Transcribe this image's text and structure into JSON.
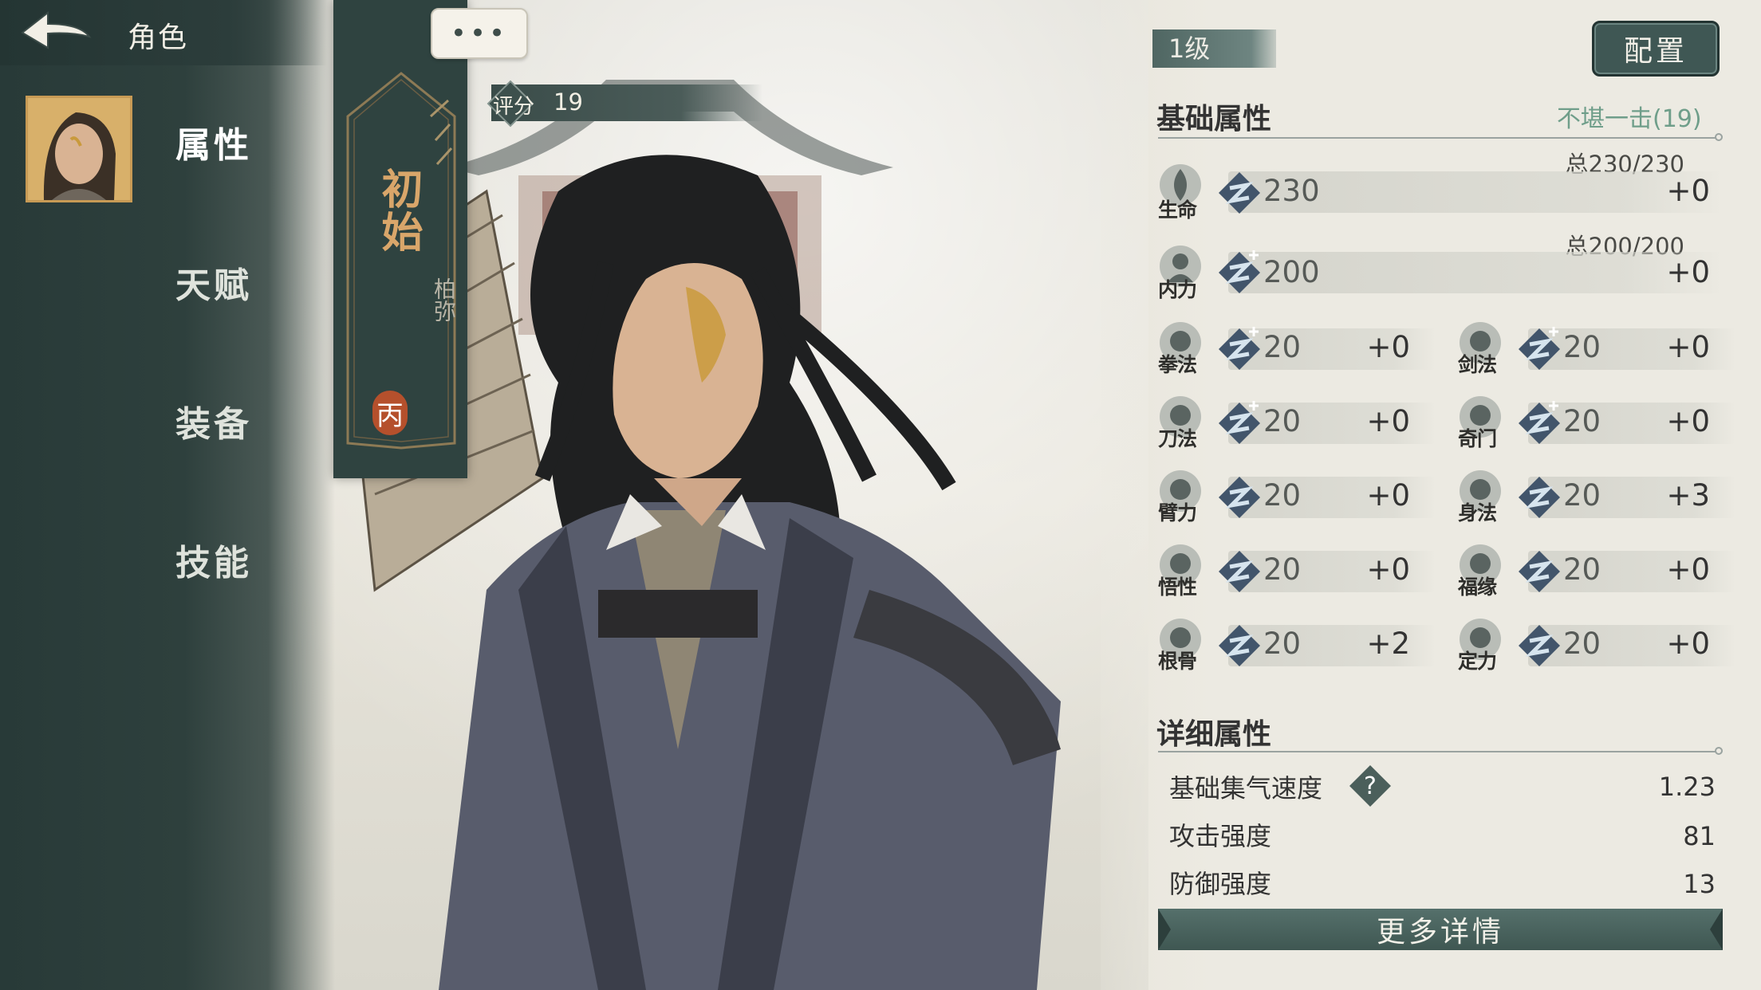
{
  "header": {
    "title": "角色",
    "chat_label": "•••"
  },
  "sidebar": {
    "items": [
      {
        "label": "属性",
        "active": true
      },
      {
        "label": "天赋",
        "active": false
      },
      {
        "label": "装备",
        "active": false
      },
      {
        "label": "技能",
        "active": false
      }
    ]
  },
  "banner": {
    "title": "初始",
    "name": "柏弥",
    "rank": "丙"
  },
  "score": {
    "label": "评分",
    "value": "19"
  },
  "level": {
    "label": "1级"
  },
  "config_label": "配置",
  "basic": {
    "title": "基础属性",
    "note": "不堪一击(19)",
    "hp": {
      "label": "生命",
      "value": "230",
      "bonus": "+0",
      "total": "总230/230",
      "icon": "leaf-icon"
    },
    "mp": {
      "label": "内力",
      "value": "200",
      "bonus": "+0",
      "total": "总200/200",
      "icon": "inner-force-icon"
    },
    "stats": [
      {
        "label": "拳法",
        "value": "20",
        "bonus": "+0",
        "icon": "fist-icon"
      },
      {
        "label": "剑法",
        "value": "20",
        "bonus": "+0",
        "icon": "sword-icon"
      },
      {
        "label": "刀法",
        "value": "20",
        "bonus": "+0",
        "icon": "blade-icon"
      },
      {
        "label": "奇门",
        "value": "20",
        "bonus": "+0",
        "icon": "odd-weapon-icon"
      },
      {
        "label": "臂力",
        "value": "20",
        "bonus": "+0",
        "icon": "arm-icon"
      },
      {
        "label": "身法",
        "value": "20",
        "bonus": "+3",
        "icon": "agility-icon"
      },
      {
        "label": "悟性",
        "value": "20",
        "bonus": "+0",
        "icon": "book-icon"
      },
      {
        "label": "福缘",
        "value": "20",
        "bonus": "+0",
        "icon": "fortune-icon"
      },
      {
        "label": "根骨",
        "value": "20",
        "bonus": "+2",
        "icon": "constitution-icon"
      },
      {
        "label": "定力",
        "value": "20",
        "bonus": "+0",
        "icon": "meditation-icon"
      }
    ]
  },
  "detail": {
    "title": "详细属性",
    "rows": [
      {
        "label": "基础集气速度",
        "value": "1.23"
      },
      {
        "label": "攻击强度",
        "value": "81"
      },
      {
        "label": "防御强度",
        "value": "13"
      }
    ],
    "more_label": "更多详情"
  },
  "colors": {
    "accent": "#3f5754",
    "sidebar": "#2e403d",
    "note": "#6f9e8a",
    "rank": "#b5502c"
  }
}
